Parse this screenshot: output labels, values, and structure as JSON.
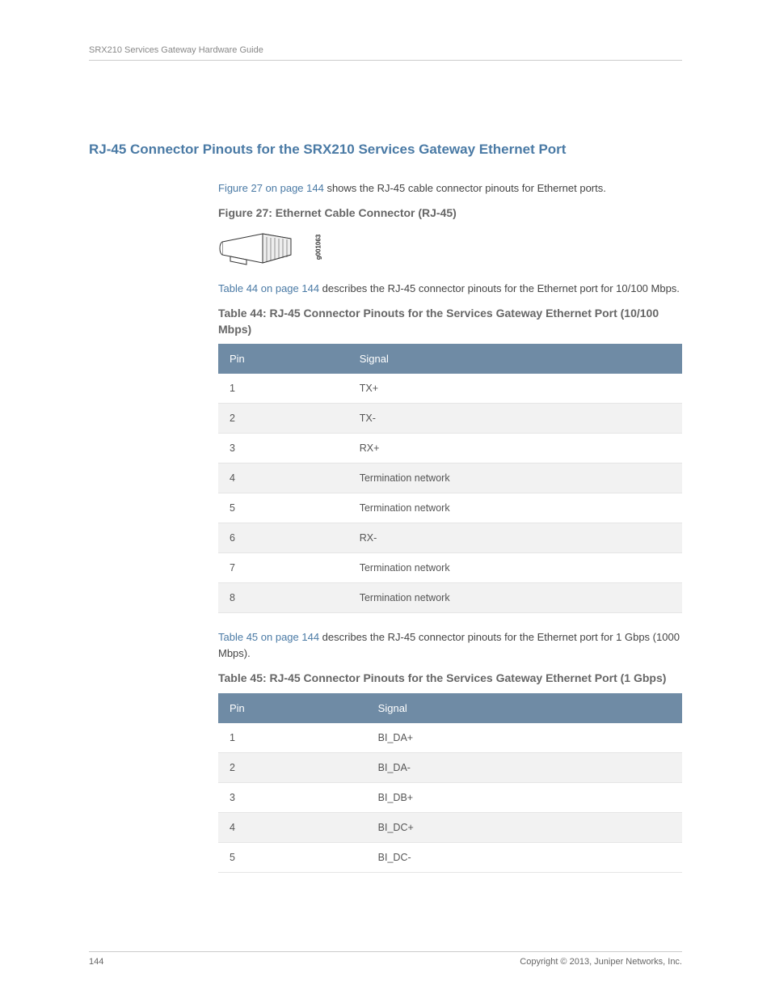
{
  "header": {
    "title": "SRX210 Services Gateway Hardware Guide"
  },
  "section": {
    "title": "RJ-45 Connector Pinouts for the SRX210 Services Gateway Ethernet Port"
  },
  "para1": {
    "link": "Figure 27 on page 144",
    "text": " shows the RJ-45 cable connector pinouts for Ethernet ports."
  },
  "figure27": {
    "caption": "Figure 27: Ethernet Cable Connector (RJ-45)",
    "label": "g001063"
  },
  "para2": {
    "link": "Table 44 on page 144",
    "text": " describes the RJ-45 connector pinouts for the Ethernet port for 10/100 Mbps."
  },
  "table44": {
    "caption": "Table 44: RJ-45 Connector Pinouts for the Services Gateway Ethernet Port (10/100 Mbps)",
    "headers": {
      "pin": "Pin",
      "signal": "Signal"
    },
    "rows": [
      {
        "pin": "1",
        "signal": "TX+"
      },
      {
        "pin": "2",
        "signal": "TX-"
      },
      {
        "pin": "3",
        "signal": "RX+"
      },
      {
        "pin": "4",
        "signal": "Termination network"
      },
      {
        "pin": "5",
        "signal": "Termination network"
      },
      {
        "pin": "6",
        "signal": "RX-"
      },
      {
        "pin": "7",
        "signal": "Termination network"
      },
      {
        "pin": "8",
        "signal": "Termination network"
      }
    ]
  },
  "para3": {
    "link": "Table 45 on page 144",
    "text": " describes the RJ-45 connector pinouts for the Ethernet port for 1 Gbps (1000 Mbps)."
  },
  "table45": {
    "caption": "Table 45: RJ-45 Connector Pinouts for the Services Gateway Ethernet Port (1 Gbps)",
    "headers": {
      "pin": "Pin",
      "signal": "Signal"
    },
    "rows": [
      {
        "pin": "1",
        "signal": "BI_DA+"
      },
      {
        "pin": "2",
        "signal": "BI_DA-"
      },
      {
        "pin": "3",
        "signal": "BI_DB+"
      },
      {
        "pin": "4",
        "signal": "BI_DC+"
      },
      {
        "pin": "5",
        "signal": "BI_DC-"
      }
    ]
  },
  "footer": {
    "page": "144",
    "copyright": "Copyright © 2013, Juniper Networks, Inc."
  }
}
